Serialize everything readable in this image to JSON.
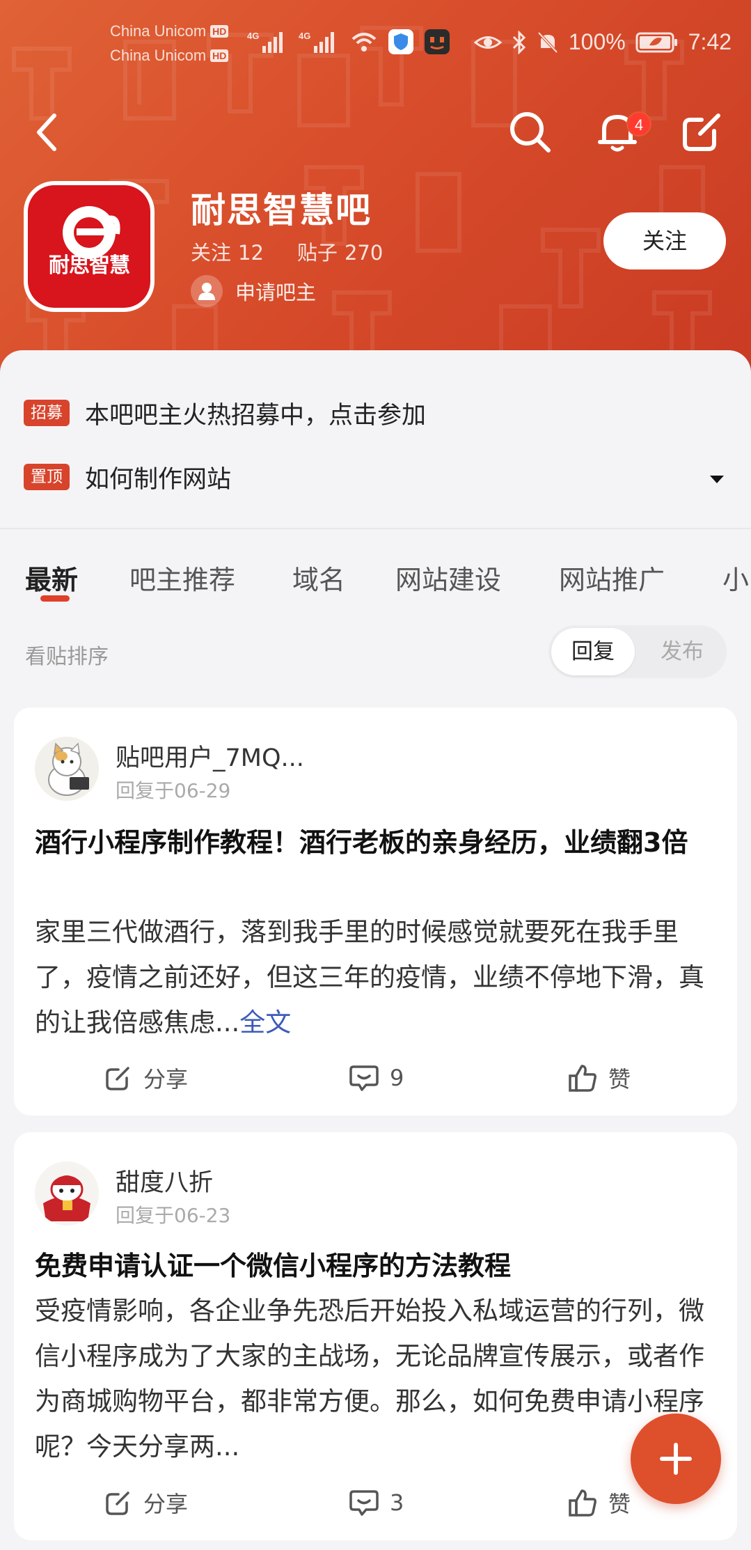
{
  "status_bar": {
    "carrier_1": "China Unicom",
    "carrier_2": "China Unicom",
    "hd_badge": "HD",
    "network_label": "4G",
    "battery": "100%",
    "time": "7:42"
  },
  "nav": {
    "notification_count": "4"
  },
  "forum": {
    "logo_text": "耐思智慧",
    "name": "耐思智慧吧",
    "follow_label": "关注",
    "follow_count": "12",
    "posts_label": "贴子",
    "posts_count": "270",
    "apply_owner": "申请吧主",
    "follow_button": "关注"
  },
  "pinned": [
    {
      "tag": "招募",
      "text": "本吧吧主火热招募中，点击参加"
    },
    {
      "tag": "置顶",
      "text": "如何制作网站"
    }
  ],
  "tabs": [
    {
      "label": "最新",
      "active": true
    },
    {
      "label": "吧主推荐",
      "active": false
    },
    {
      "label": "域名",
      "active": false
    },
    {
      "label": "网站建设",
      "active": false
    },
    {
      "label": "网站推广",
      "active": false
    },
    {
      "label": "小",
      "active": false
    }
  ],
  "sort": {
    "label": "看贴排序",
    "option_reply": "回复",
    "option_publish": "发布",
    "selected": "回复"
  },
  "posts": [
    {
      "author": "贴吧用户_7MQ...",
      "reply_time": "回复于06-29",
      "title": "酒行小程序制作教程！酒行老板的亲身经历，业绩翻3倍",
      "body": "家里三代做酒行，落到我手里的时候感觉就要死在我手里了，疫情之前还好，但这三年的疫情，业绩不停地下滑，真的让我倍感焦虑...",
      "more": "全文",
      "share": "分享",
      "comments": "9",
      "like": "赞"
    },
    {
      "author": "甜度八折",
      "reply_time": "回复于06-23",
      "title": "免费申请认证一个微信小程序的方法教程",
      "body": "受疫情影响，各企业争先恐后开始投入私域运营的行列，微信小程序成为了大家的主战场，无论品牌宣传展示，或者作为商城购物平台，都非常方便。那么，如何免费申请小程序呢？今天分享两...",
      "share": "分享",
      "comments": "3",
      "like": "赞"
    }
  ],
  "colors": {
    "brand": "#d84d2b",
    "tag": "#d8432c",
    "link": "#3e5bb8"
  }
}
